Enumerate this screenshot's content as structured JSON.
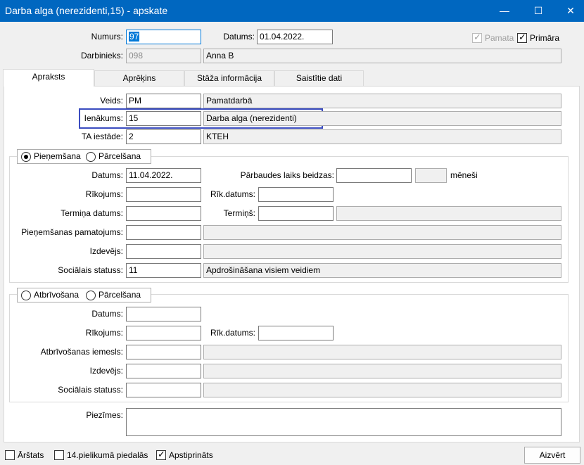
{
  "window": {
    "title": "Darba alga (nerezidenti,15) - apskate",
    "minimize": "—",
    "maximize": "☐",
    "close": "✕"
  },
  "header": {
    "numurs_label": "Numurs:",
    "numurs_value": "97",
    "datums_label": "Datums:",
    "datums_value": "01.04.2022.",
    "pamata_label": "Pamata",
    "pamata_checked": true,
    "primara_label": "Primāra",
    "primara_checked": true,
    "darbinieks_label": "Darbinieks:",
    "darbinieks_code": "098",
    "darbinieks_name": "Anna B"
  },
  "tabs": [
    {
      "label": "Apraksts",
      "active": true
    },
    {
      "label": "Aprēķins",
      "active": false
    },
    {
      "label": "Stāža informācija",
      "active": false
    },
    {
      "label": "Saistītie dati",
      "active": false
    }
  ],
  "apraksts": {
    "veids_label": "Veids:",
    "veids_code": "PM",
    "veids_name": "Pamatdarbā",
    "ienakums_label": "Ienākums:",
    "ienakums_code": "15",
    "ienakums_name": "Darba alga (nerezidenti)",
    "ta_label": "TA iestāde:",
    "ta_code": "2",
    "ta_name": "KTEH"
  },
  "hire_group": {
    "radio1": "Pieņemšana",
    "radio2": "Pārcelšana",
    "selected": "radio1",
    "datums_label": "Datums:",
    "datums_value": "11.04.2022.",
    "parbaudes_label": "Pārbaudes laiks beidzas:",
    "parbaudes_value": "",
    "menesi_value": "",
    "menesi_label": "mēneši",
    "rikojums_label": "Rīkojums:",
    "rikojums_value": "",
    "rik_datums_label": "Rīk.datums:",
    "rik_datums_value": "",
    "termina_datums_label": "Termiņa datums:",
    "termina_datums_value": "",
    "termins_label": "Termiņš:",
    "termins_value": "",
    "termins_desc": "",
    "pamatojums_label": "Pieņemšanas pamatojums:",
    "pamatojums_value": "",
    "pamatojums_desc": "",
    "izdevejs_label": "Izdevējs:",
    "izdevejs_value": "",
    "izdevejs_desc": "",
    "statuss_label": "Sociālais statuss:",
    "statuss_code": "11",
    "statuss_name": "Apdrošināšana visiem veidiem"
  },
  "release_group": {
    "radio1": "Atbrīvošana",
    "radio2": "Pārcelšana",
    "datums_label": "Datums:",
    "datums_value": "",
    "rikojums_label": "Rīkojums:",
    "rikojums_value": "",
    "rik_datums_label": "Rīk.datums:",
    "rik_datums_value": "",
    "iemesls_label": "Atbrīvošanas iemesls:",
    "iemesls_value": "",
    "iemesls_desc": "",
    "izdevejs_label": "Izdevējs:",
    "izdevejs_value": "",
    "izdevejs_desc": "",
    "statuss_label": "Sociālais statuss:",
    "statuss_value": "",
    "statuss_desc": ""
  },
  "piezimes": {
    "label": "Piezīmes:",
    "value": ""
  },
  "footer": {
    "arstats_label": "Ārštats",
    "arstats_checked": false,
    "pielikums_label": "14.pielikumā piedalās",
    "pielikums_checked": false,
    "apstiprinats_label": "Apstiprināts",
    "apstiprinats_checked": true,
    "close_button": "Aizvērt"
  },
  "colors": {
    "titlebar": "#0067c0",
    "highlight": "#3b4cc0"
  }
}
